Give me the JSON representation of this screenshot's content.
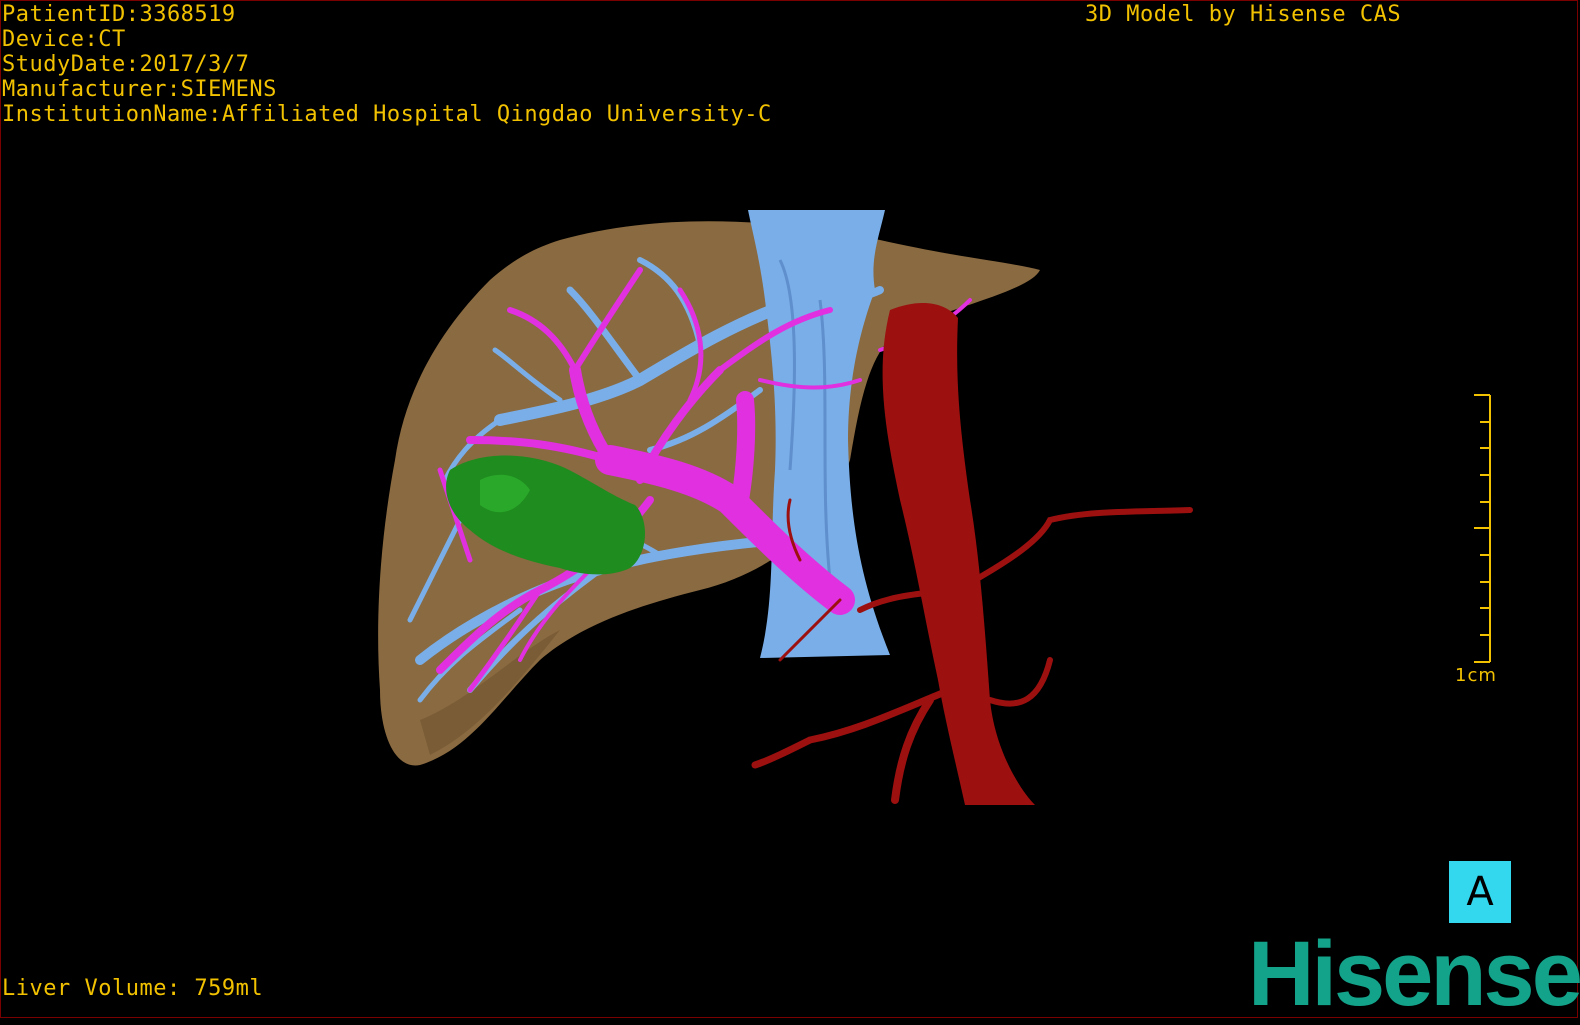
{
  "header": {
    "patient_id": "PatientID:3368519",
    "device": "Device:CT",
    "study_date": "StudyDate:2017/3/7",
    "manufacturer": "Manufacturer:SIEMENS",
    "institution": "InstitutionName:Affiliated Hospital Qingdao University-C"
  },
  "credit": "3D Model by Hisense CAS",
  "scale_bar": {
    "label": "1cm"
  },
  "orientation_label": "A",
  "footer": {
    "liver_volume": "Liver Volume: 759ml"
  },
  "logo_text": "Hisense",
  "colors": {
    "overlay_text": "#f2c200",
    "liver": "#8a6a40",
    "portal_vein": "#e030e0",
    "hepatic_vein": "#7aaee8",
    "artery": "#9c1010",
    "tumor": "#1e8c1e",
    "orientation_box": "#33d8ee",
    "logo": "#13a38a"
  },
  "icons": [
    "scale-bar-icon",
    "orientation-cube-icon"
  ]
}
